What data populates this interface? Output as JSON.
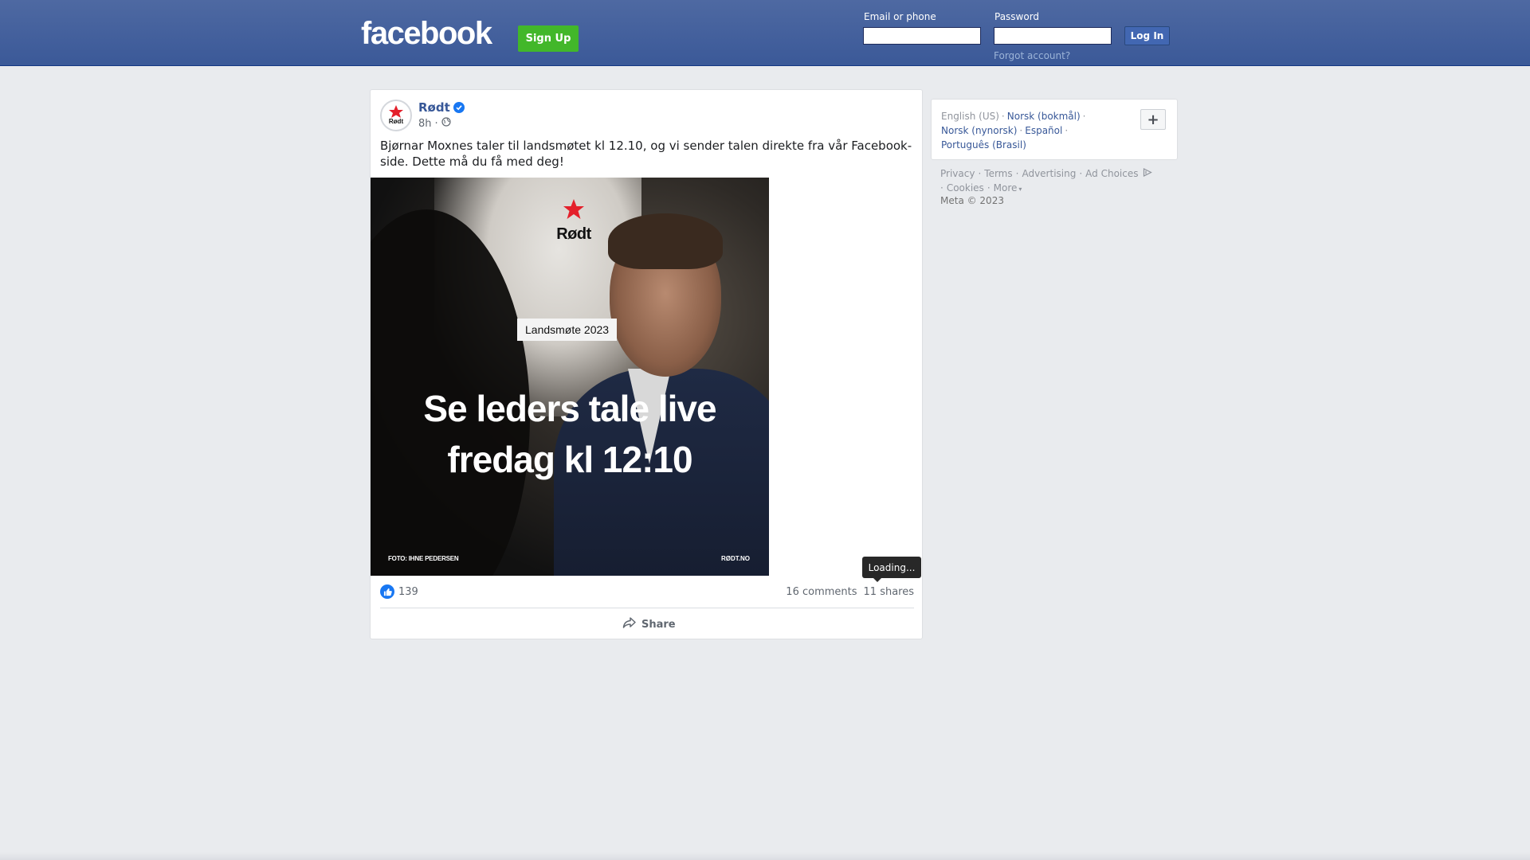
{
  "header": {
    "logo": "facebook",
    "signup_label": "Sign Up",
    "email_label": "Email or phone",
    "email_value": "",
    "password_label": "Password",
    "password_value": "",
    "login_label": "Log In",
    "forgot_label": "Forgot account?"
  },
  "post": {
    "author": "Rødt",
    "avatar_text": "Rødt",
    "time": "8h",
    "separator": "·",
    "text": "Bjørnar Moxnes taler til landsmøtet kl 12.10, og vi sender talen direkte fra vår Facebook-side. Dette må du få med deg!",
    "image": {
      "logo_text": "Rødt",
      "badge": "Landsmøte 2023",
      "headline_line1": "Se leders tale live",
      "headline_line2": "fredag kl 12:10",
      "credit": "FOTO: IHNE PEDERSEN",
      "site": "RØDT.NO"
    },
    "likes": "139",
    "comments": "16 comments",
    "shares": "11 shares",
    "share_label": "Share",
    "tooltip": "Loading..."
  },
  "sidebar": {
    "current_language": "English (US)",
    "languages": [
      "Norsk (bokmål)",
      "Norsk (nynorsk)",
      "Español",
      "Português (Brasil)"
    ],
    "plus_label": "+",
    "footer_links": [
      "Privacy",
      "Terms",
      "Advertising",
      "Ad Choices",
      "Cookies",
      "More"
    ],
    "copyright": "Meta © 2023"
  },
  "colors": {
    "brand_blue": "#3b5998",
    "signup_green": "#42b72a",
    "link_blue": "#385898",
    "like_blue": "#1877f2",
    "rodt_red": "#e4202b"
  }
}
